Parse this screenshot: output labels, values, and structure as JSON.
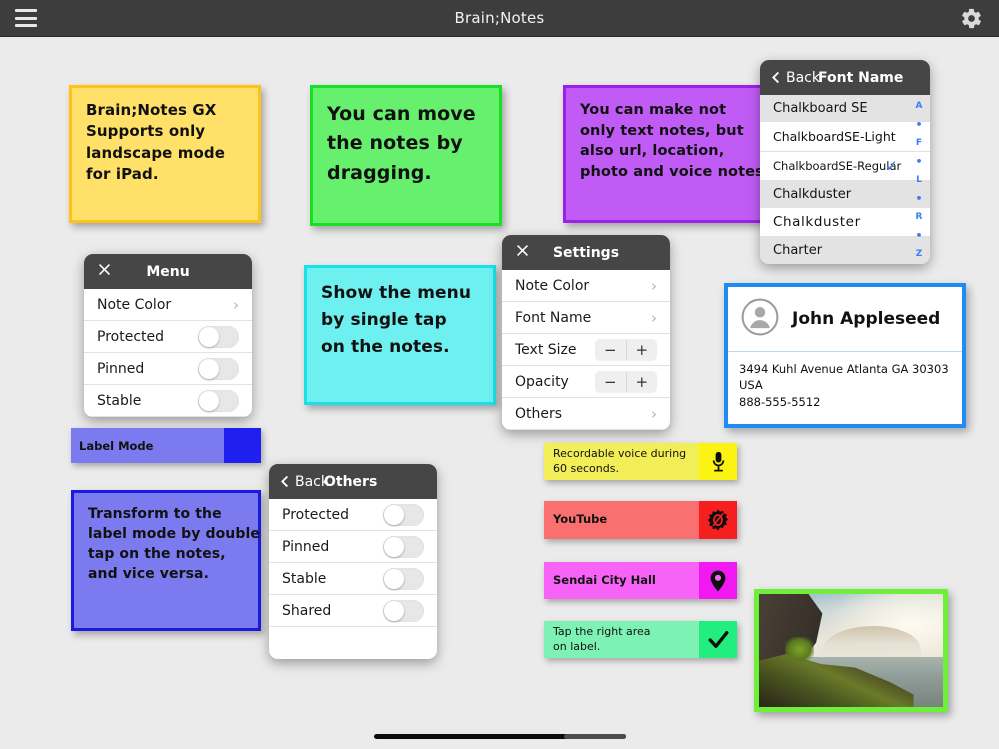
{
  "topbar": {
    "title": "Brain;Notes",
    "menu_icon": "hamburger-icon",
    "settings_icon": "gear-icon"
  },
  "notes": [
    {
      "id": "note-yellow",
      "lines": [
        "Brain;Notes GX",
        "Supports only",
        "landscape mode",
        "for iPad."
      ],
      "bg": "#ffe069",
      "border": "#ffc219"
    },
    {
      "id": "note-green",
      "lines": [
        "You can move",
        "the notes by",
        "dragging."
      ],
      "bg": "#66f06e",
      "border": "#17e024"
    },
    {
      "id": "note-purple",
      "lines": [
        "You can make not",
        "only text notes, but",
        "also url, location,",
        "photo and voice notes."
      ],
      "bg": "#c05cf5",
      "border": "#9b20e8"
    },
    {
      "id": "note-cyan",
      "lines": [
        "Show the menu",
        "by single tap",
        "on the notes."
      ],
      "bg": "#6ef0f0",
      "border": "#1ae0e8"
    },
    {
      "id": "note-blueviolet",
      "lines": [
        "Transform to the",
        "label mode by double",
        "tap on the notes,",
        "and vice versa."
      ],
      "bg": "#7b7bef",
      "border": "#1a1ae0"
    }
  ],
  "menu_panel": {
    "title": "Menu",
    "close_icon": "close-icon",
    "rows": [
      {
        "label": "Note Color",
        "type": "chevron"
      },
      {
        "label": "Protected",
        "type": "toggle",
        "on": false
      },
      {
        "label": "Pinned",
        "type": "toggle",
        "on": false
      },
      {
        "label": "Stable",
        "type": "toggle",
        "on": false
      }
    ]
  },
  "settings_panel": {
    "title": "Settings",
    "close_icon": "close-icon",
    "rows": [
      {
        "label": "Note Color",
        "type": "chevron"
      },
      {
        "label": "Font Name",
        "type": "chevron"
      },
      {
        "label": "Text Size",
        "type": "stepper",
        "minus": "−",
        "plus": "+"
      },
      {
        "label": "Opacity",
        "type": "stepper",
        "minus": "−",
        "plus": "+"
      },
      {
        "label": "Others",
        "type": "chevron"
      }
    ]
  },
  "others_panel": {
    "back_label": "Back",
    "title": "Others",
    "back_icon": "chevron-left-icon",
    "rows": [
      {
        "label": "Protected",
        "on": false
      },
      {
        "label": "Pinned",
        "on": false
      },
      {
        "label": "Stable",
        "on": false
      },
      {
        "label": "Shared",
        "on": false
      }
    ]
  },
  "font_panel": {
    "back_label": "Back",
    "title": "Font Name",
    "back_icon": "chevron-left-icon",
    "check_icon": "checkmark-icon",
    "fonts": [
      {
        "name": "Chalkboard SE",
        "selected": false,
        "alt": true
      },
      {
        "name": "ChalkboardSE-Light",
        "selected": false,
        "alt": false
      },
      {
        "name": "ChalkboardSE-Regular",
        "selected": true,
        "alt": false
      },
      {
        "name": "Chalkduster",
        "selected": false,
        "alt": true
      },
      {
        "name": "Chalkduster",
        "selected": false,
        "alt": false
      },
      {
        "name": "Charter",
        "selected": false,
        "alt": true
      }
    ],
    "index": [
      "A",
      "•",
      "F",
      "•",
      "L",
      "•",
      "R",
      "•",
      "Z"
    ]
  },
  "contact_card": {
    "avatar_icon": "person-icon",
    "name": "John Appleseed",
    "address_line1": "3494 Kuhl Avenue Atlanta GA 30303",
    "address_line2": "USA",
    "phone": "888-555-5512",
    "accent": "#1f8cf5"
  },
  "label_mode_bar": {
    "label": "Label Mode",
    "bg": "#7b7bef",
    "swatch": "#1f1ff0"
  },
  "label_notes": [
    {
      "id": "label-voice",
      "lines": [
        "Recordable voice during",
        "60 seconds."
      ],
      "bg": "#f2ee57",
      "icon_bg": "#fbf413",
      "icon": "microphone-icon",
      "chalk": false
    },
    {
      "id": "label-youtube",
      "lines": [
        "YouTube"
      ],
      "bg": "#fa7070",
      "icon_bg": "#f51f1f",
      "icon": "url-icon",
      "chalk": true
    },
    {
      "id": "label-location",
      "lines": [
        "Sendai City Hall"
      ],
      "bg": "#f763f7",
      "icon_bg": "#f218f2",
      "icon": "map-pin-icon",
      "chalk": true
    },
    {
      "id": "label-check",
      "lines": [
        "Tap the right area",
        "on label."
      ],
      "bg": "#7ef2b5",
      "icon_bg": "#21ee7e",
      "icon": "checkmark-icon",
      "chalk": false
    }
  ],
  "photo_note": {
    "border": "#6ef03a",
    "alt": "waterfall-landscape-photo"
  },
  "home_indicator": "home-indicator"
}
